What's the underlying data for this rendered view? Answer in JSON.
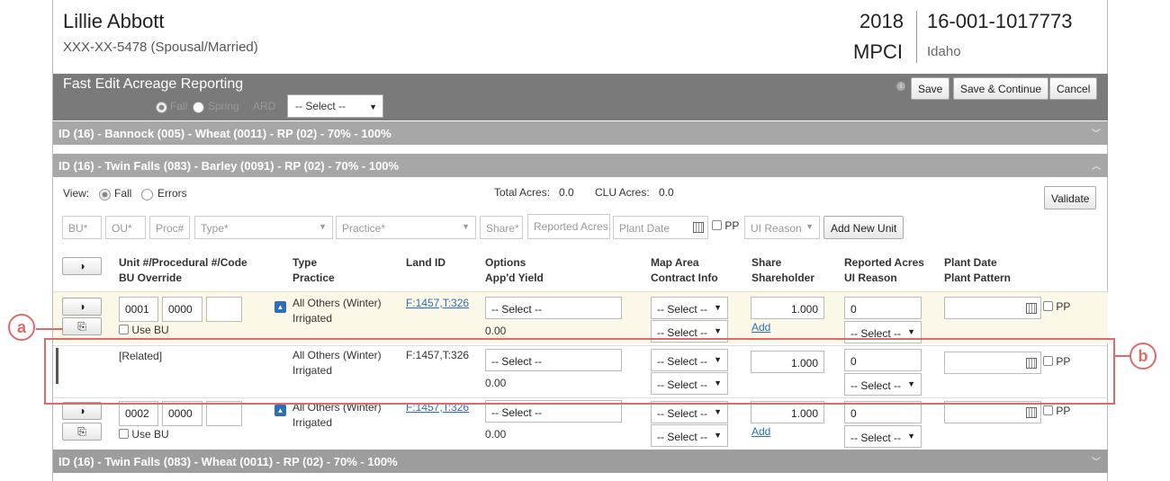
{
  "header": {
    "name": "Lillie Abbott",
    "ssn_status": "XXX-XX-5478 (Spousal/Married)",
    "year": "2018",
    "program": "MPCI",
    "policy_number": "16-001-1017773",
    "state": "Idaho"
  },
  "fast_edit": {
    "title": "Fast Edit Acreage Reporting",
    "fall_label": "Fall",
    "spring_label": "Spring",
    "ard_label": "ARD",
    "select_value": "-- Select --",
    "save_label": "Save",
    "save_continue_label": "Save & Continue",
    "cancel_label": "Cancel"
  },
  "sections": {
    "s1": "ID (16) - Bannock (005) - Wheat (0011) - RP (02) - 70% - 100%",
    "s2": "ID (16) - Twin Falls (083) - Barley (0091) - RP (02) - 70% - 100%",
    "s3": "ID (16) - Twin Falls (083) - Wheat (0011) - RP (02) - 70% - 100%"
  },
  "view": {
    "label": "View:",
    "fall": "Fall",
    "errors": "Errors",
    "total_acres_label": "Total Acres:",
    "total_acres_value": "0.0",
    "clu_acres_label": "CLU Acres:",
    "clu_acres_value": "0.0",
    "validate_label": "Validate"
  },
  "new_unit": {
    "bu": "BU*",
    "ou": "OU*",
    "proc": "Proc#",
    "type": "Type*",
    "practice": "Practice*",
    "share": "Share*",
    "reported_acres": "Reported Acres",
    "plant_date": "Plant Date",
    "pp_label": "PP",
    "ui_reason": "UI Reason",
    "add_label": "Add New Unit"
  },
  "columns": {
    "unit_1": "Unit #/Procedural #/Code",
    "unit_2": "BU Override",
    "type_1": "Type",
    "type_2": "Practice",
    "land": "Land ID",
    "options_1": "Options",
    "options_2": "App'd Yield",
    "map_1": "Map Area",
    "map_2": "Contract Info",
    "share_1": "Share",
    "share_2": "Shareholder",
    "rep_1": "Reported Acres",
    "rep_2": "UI Reason",
    "plant_1": "Plant Date",
    "plant_2": "Plant Pattern"
  },
  "rows": [
    {
      "unit": "0001",
      "proc": "0000",
      "use_bu": "Use BU",
      "type": "All Others (Winter)",
      "practice": "Irrigated",
      "land_id": "F:1457,T:326",
      "options": "-- Select --",
      "yield": "0.00",
      "map": "-- Select --",
      "contract": "-- Select --",
      "share": "1.000",
      "add": "Add",
      "acres": "0",
      "ui": "-- Select --",
      "pp": "PP"
    },
    {
      "related": "[Related]",
      "type": "All Others (Winter)",
      "practice": "Irrigated",
      "land_id": "F:1457,T:326",
      "options": "-- Select --",
      "yield": "0.00",
      "map": "-- Select --",
      "contract": "-- Select --",
      "share": "1.000",
      "acres": "0",
      "ui": "-- Select --",
      "pp": "PP"
    },
    {
      "unit": "0002",
      "proc": "0000",
      "use_bu": "Use BU",
      "type": "All Others (Winter)",
      "practice": "Irrigated",
      "land_id": "F:1457,T:326",
      "options": "-- Select --",
      "yield": "0.00",
      "map": "-- Select --",
      "contract": "-- Select --",
      "share": "1.000",
      "add": "Add",
      "acres": "0",
      "ui": "-- Select --",
      "pp": "PP"
    }
  ],
  "callouts": {
    "a": "a",
    "b": "b"
  },
  "colors": {
    "accent": "#e06a6a",
    "link": "#2a6ebb",
    "row_highlight": "#fcf8e7"
  }
}
